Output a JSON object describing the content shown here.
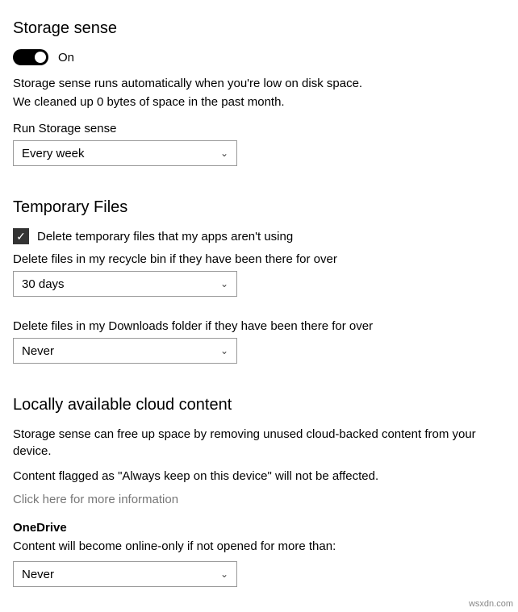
{
  "storageSense": {
    "title": "Storage sense",
    "toggleLabel": "On",
    "desc1": "Storage sense runs automatically when you're low on disk space.",
    "desc2": "We cleaned up 0 bytes of space in the past month.",
    "runLabel": "Run Storage sense",
    "runValue": "Every week"
  },
  "temporaryFiles": {
    "title": "Temporary Files",
    "checkboxLabel": "Delete temporary files that my apps aren't using",
    "recycleLabel": "Delete files in my recycle bin if they have been there for over",
    "recycleValue": "30 days",
    "downloadsLabel": "Delete files in my Downloads folder if they have been there for over",
    "downloadsValue": "Never"
  },
  "cloud": {
    "title": "Locally available cloud content",
    "desc1": "Storage sense can free up space by removing unused cloud-backed content from your device.",
    "desc2": "Content flagged as \"Always keep on this device\" will not be affected.",
    "link": "Click here for more information",
    "onedriveTitle": "OneDrive",
    "onedriveDesc": "Content will become online-only if not opened for more than:",
    "onedriveValue": "Never"
  },
  "watermark": "wsxdn.com"
}
